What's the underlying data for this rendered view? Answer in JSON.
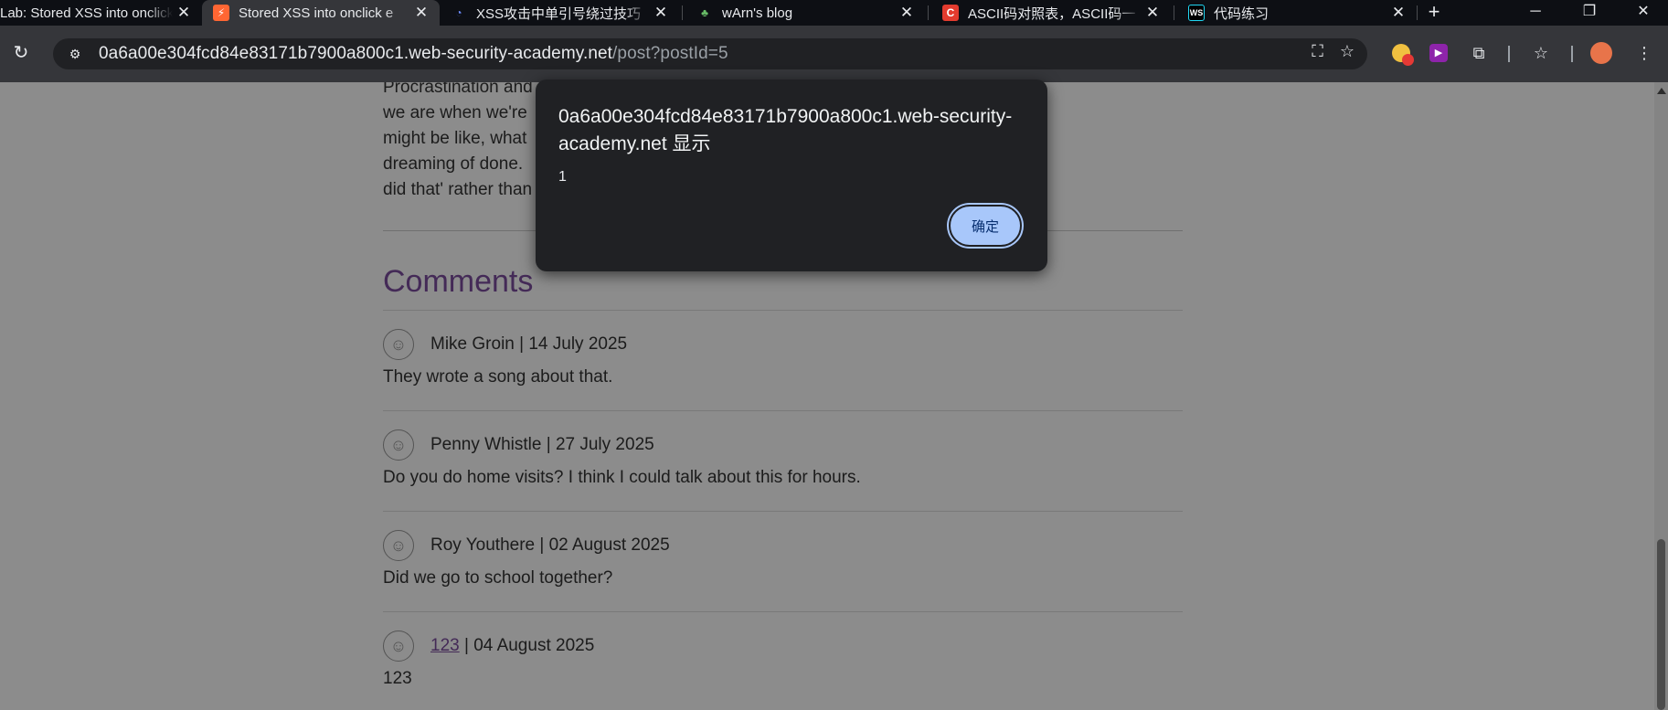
{
  "tabs": [
    {
      "title": "Lab: Stored XSS into onclick",
      "favicon": "lab-icon",
      "close": "✕"
    },
    {
      "title": "Stored XSS into onclick e",
      "favicon": "portswigger-icon",
      "close": "✕"
    },
    {
      "title": "XSS攻击中单引号绕过技巧",
      "favicon": "blog-icon",
      "close": "✕"
    },
    {
      "title": "wArn's blog",
      "favicon": "plant-icon",
      "close": "✕"
    },
    {
      "title": "ASCII码对照表，ASCII码一",
      "favicon": "csdn-icon",
      "close": "✕"
    },
    {
      "title": "代码练习",
      "favicon": "webstorm-icon",
      "close": "✕"
    }
  ],
  "toolbar": {
    "url_host": "0a6a00e304fcd84e83171b7900a800c1.web-security-academy.net",
    "url_path": "/post?postId=5"
  },
  "post": {
    "lines": [
      "Procrastination and                                                              w exactly who",
      "we are when we're                                                                  t know what we",
      "might be like, what                                                               ngs we're",
      "dreaming of done.                                                                  hink 'I'm so glad I",
      "did that' rather than"
    ]
  },
  "comments_heading": "Comments",
  "comments": [
    {
      "author": "Mike Groin",
      "date": "14 July 2025",
      "body": "They wrote a song about that.",
      "author_link": false
    },
    {
      "author": "Penny Whistle",
      "date": "27 July 2025",
      "body": "Do you do home visits? I think I could talk about this for hours.",
      "author_link": false
    },
    {
      "author": "Roy Youthere",
      "date": "02 August 2025",
      "body": "Did we go to school together?",
      "author_link": false
    },
    {
      "author": "123",
      "date": "04 August 2025",
      "body": "123",
      "author_link": true
    }
  ],
  "dialog": {
    "title": "0a6a00e304fcd84e83171b7900a800c1.web-security-academy.net 显示",
    "message": "1",
    "ok_label": "确定"
  },
  "colors": {
    "accent_purple": "#7c4e9f",
    "dialog_button": "#a8c7fa"
  }
}
